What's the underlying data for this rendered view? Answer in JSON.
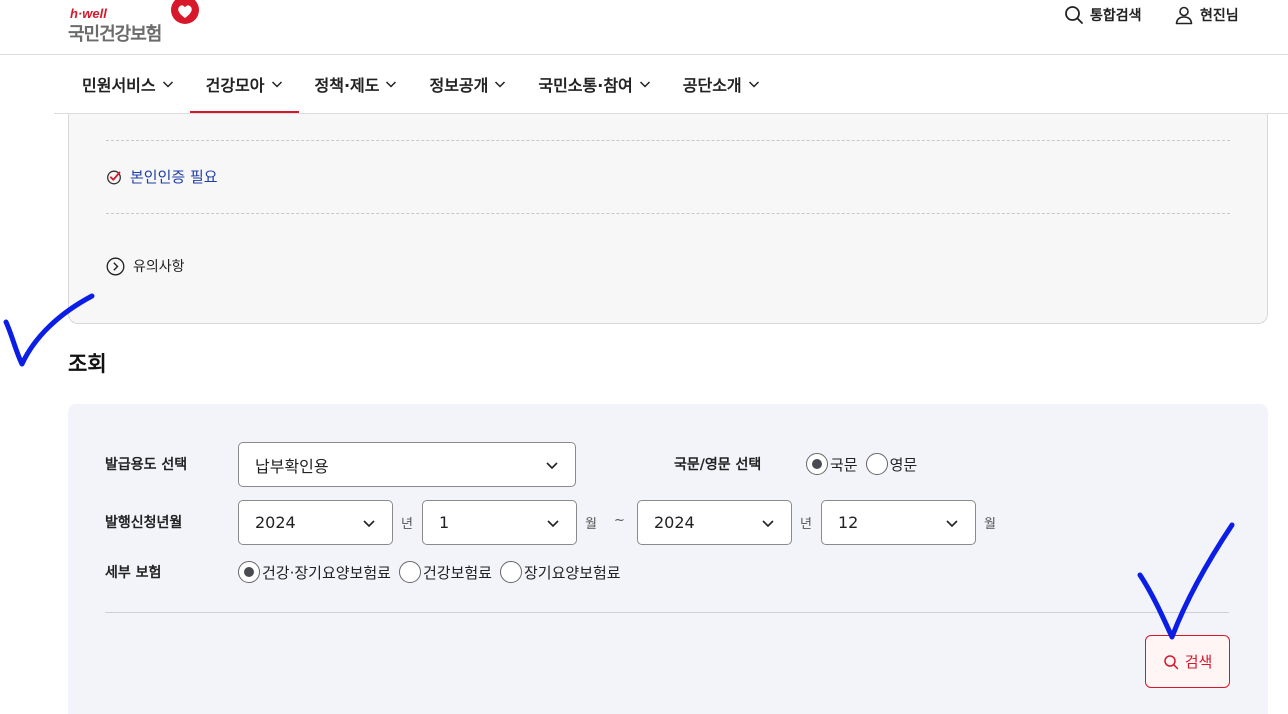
{
  "header": {
    "logo_small": "h·well",
    "logo_main": "국민건강보험",
    "utility": {
      "search_label": "통합검색",
      "user_label": "현진님"
    },
    "nav": [
      {
        "label": "민원서비스",
        "active": false
      },
      {
        "label": "건강모아",
        "active": true
      },
      {
        "label": "정책·제도",
        "active": false
      },
      {
        "label": "정보공개",
        "active": false
      },
      {
        "label": "국민소통·참여",
        "active": false
      },
      {
        "label": "공단소개",
        "active": false
      }
    ]
  },
  "info": {
    "cert_label": "본인인증 필요",
    "notice_label": "유의사항"
  },
  "section": {
    "title": "조회"
  },
  "form": {
    "purpose": {
      "label": "발급용도 선택",
      "value": "납부확인용"
    },
    "language": {
      "label": "국문/영문 선택",
      "options": [
        {
          "label": "국문",
          "checked": true
        },
        {
          "label": "영문",
          "checked": false
        }
      ]
    },
    "period": {
      "label": "발행신청년월",
      "from_year": "2024",
      "from_month": "1",
      "to_year": "2024",
      "to_month": "12",
      "year_unit": "년",
      "month_unit": "월",
      "range_sep": "~"
    },
    "insurance": {
      "label": "세부 보험",
      "options": [
        {
          "label": "건강·장기요양보험료",
          "checked": true
        },
        {
          "label": "건강보험료",
          "checked": false
        },
        {
          "label": "장기요양보험료",
          "checked": false
        }
      ]
    },
    "search_button": "검색"
  },
  "colors": {
    "accent": "#d7182a",
    "link": "#1f3fa8",
    "annotation": "#0a1ee6"
  },
  "icons": [
    "search-icon",
    "user-icon",
    "chevron-down-icon",
    "check-circle-icon",
    "arrow-right-circle-icon",
    "heart-logo-icon"
  ]
}
